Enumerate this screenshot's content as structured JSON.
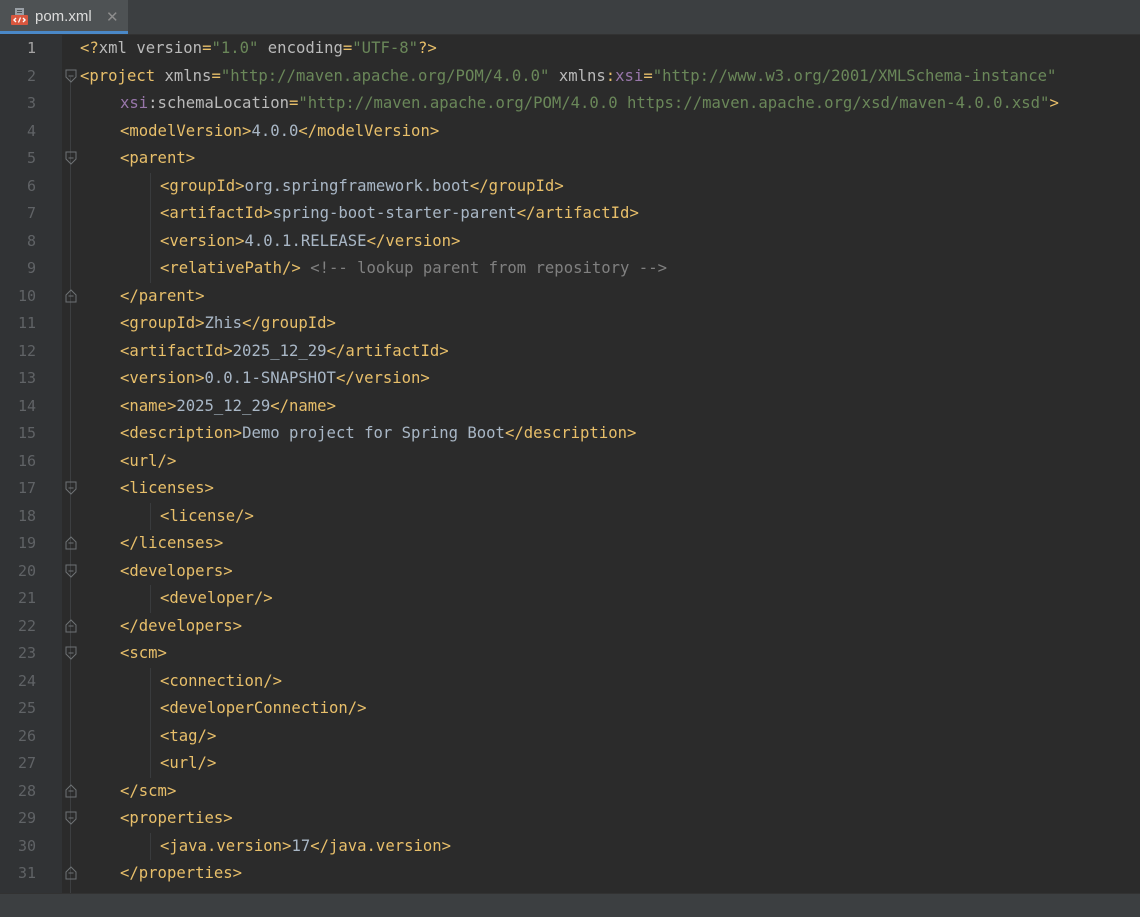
{
  "tab": {
    "label": "pom.xml",
    "close": "✕",
    "icon": "xml-file-icon"
  },
  "lines": [
    {
      "n": "1",
      "indent": 0,
      "fold": "none",
      "tokens": [
        [
          "t",
          "<?"
        ],
        [
          "a",
          "xml"
        ],
        [
          "a",
          " version"
        ],
        [
          "t",
          "="
        ],
        [
          "v",
          "\"1.0\""
        ],
        [
          "a",
          " encoding"
        ],
        [
          "t",
          "="
        ],
        [
          "v",
          "\"UTF-8\""
        ],
        [
          "t",
          "?>"
        ]
      ]
    },
    {
      "n": "2",
      "indent": 0,
      "fold": "open",
      "tokens": [
        [
          "t",
          "<project"
        ],
        [
          "a",
          " xmlns"
        ],
        [
          "t",
          "="
        ],
        [
          "v",
          "\"http://maven.apache.org/POM/4.0.0\""
        ],
        [
          "a",
          " xmlns"
        ],
        [
          "t",
          ":"
        ],
        [
          "ns",
          "xsi"
        ],
        [
          "t",
          "="
        ],
        [
          "v",
          "\"http://www.w3.org/2001/XMLSchema-instance\""
        ]
      ]
    },
    {
      "n": "3",
      "indent": 1,
      "fold": "none",
      "tokens": [
        [
          "ns",
          "xsi"
        ],
        [
          "a",
          ":schemaLocation"
        ],
        [
          "t",
          "="
        ],
        [
          "v",
          "\"http://maven.apache.org/POM/4.0.0 https://maven.apache.org/xsd/maven-4.0.0.xsd\""
        ],
        [
          "t",
          ">"
        ]
      ]
    },
    {
      "n": "4",
      "indent": 1,
      "fold": "none",
      "tokens": [
        [
          "t",
          "<modelVersion>"
        ],
        [
          "txt",
          "4.0.0"
        ],
        [
          "t",
          "</modelVersion>"
        ]
      ]
    },
    {
      "n": "5",
      "indent": 1,
      "fold": "open",
      "tokens": [
        [
          "t",
          "<parent>"
        ]
      ]
    },
    {
      "n": "6",
      "indent": 2,
      "fold": "none",
      "tokens": [
        [
          "t",
          "<groupId>"
        ],
        [
          "txt",
          "org.springframework.boot"
        ],
        [
          "t",
          "</groupId>"
        ]
      ]
    },
    {
      "n": "7",
      "indent": 2,
      "fold": "none",
      "tokens": [
        [
          "t",
          "<artifactId>"
        ],
        [
          "txt",
          "spring-boot-starter-parent"
        ],
        [
          "t",
          "</artifactId>"
        ]
      ]
    },
    {
      "n": "8",
      "indent": 2,
      "fold": "none",
      "tokens": [
        [
          "t",
          "<version>"
        ],
        [
          "txt",
          "4.0.1.RELEASE"
        ],
        [
          "t",
          "</version>"
        ]
      ]
    },
    {
      "n": "9",
      "indent": 2,
      "fold": "none",
      "tokens": [
        [
          "t",
          "<relativePath/>"
        ],
        [
          "c",
          " <!-- lookup parent from repository -->"
        ]
      ]
    },
    {
      "n": "10",
      "indent": 1,
      "fold": "close",
      "tokens": [
        [
          "t",
          "</parent>"
        ]
      ]
    },
    {
      "n": "11",
      "indent": 1,
      "fold": "none",
      "tokens": [
        [
          "t",
          "<groupId>"
        ],
        [
          "txt",
          "Zhis"
        ],
        [
          "t",
          "</groupId>"
        ]
      ]
    },
    {
      "n": "12",
      "indent": 1,
      "fold": "none",
      "tokens": [
        [
          "t",
          "<artifactId>"
        ],
        [
          "txt",
          "2025_12_29"
        ],
        [
          "t",
          "</artifactId>"
        ]
      ]
    },
    {
      "n": "13",
      "indent": 1,
      "fold": "none",
      "tokens": [
        [
          "t",
          "<version>"
        ],
        [
          "txt",
          "0.0.1-SNAPSHOT"
        ],
        [
          "t",
          "</version>"
        ]
      ]
    },
    {
      "n": "14",
      "indent": 1,
      "fold": "none",
      "tokens": [
        [
          "t",
          "<name>"
        ],
        [
          "txt",
          "2025_12_29"
        ],
        [
          "t",
          "</name>"
        ]
      ]
    },
    {
      "n": "15",
      "indent": 1,
      "fold": "none",
      "tokens": [
        [
          "t",
          "<description>"
        ],
        [
          "txt",
          "Demo project for Spring Boot"
        ],
        [
          "t",
          "</description>"
        ]
      ]
    },
    {
      "n": "16",
      "indent": 1,
      "fold": "none",
      "tokens": [
        [
          "t",
          "<url/>"
        ]
      ]
    },
    {
      "n": "17",
      "indent": 1,
      "fold": "open",
      "tokens": [
        [
          "t",
          "<licenses>"
        ]
      ]
    },
    {
      "n": "18",
      "indent": 2,
      "fold": "none",
      "tokens": [
        [
          "t",
          "<license/>"
        ]
      ]
    },
    {
      "n": "19",
      "indent": 1,
      "fold": "close",
      "tokens": [
        [
          "t",
          "</licenses>"
        ]
      ]
    },
    {
      "n": "20",
      "indent": 1,
      "fold": "open",
      "tokens": [
        [
          "t",
          "<developers>"
        ]
      ]
    },
    {
      "n": "21",
      "indent": 2,
      "fold": "none",
      "tokens": [
        [
          "t",
          "<developer/>"
        ]
      ]
    },
    {
      "n": "22",
      "indent": 1,
      "fold": "close",
      "tokens": [
        [
          "t",
          "</developers>"
        ]
      ]
    },
    {
      "n": "23",
      "indent": 1,
      "fold": "open",
      "tokens": [
        [
          "t",
          "<scm>"
        ]
      ]
    },
    {
      "n": "24",
      "indent": 2,
      "fold": "none",
      "tokens": [
        [
          "t",
          "<connection/>"
        ]
      ]
    },
    {
      "n": "25",
      "indent": 2,
      "fold": "none",
      "tokens": [
        [
          "t",
          "<developerConnection/>"
        ]
      ]
    },
    {
      "n": "26",
      "indent": 2,
      "fold": "none",
      "tokens": [
        [
          "t",
          "<tag/>"
        ]
      ]
    },
    {
      "n": "27",
      "indent": 2,
      "fold": "none",
      "tokens": [
        [
          "t",
          "<url/>"
        ]
      ]
    },
    {
      "n": "28",
      "indent": 1,
      "fold": "close",
      "tokens": [
        [
          "t",
          "</scm>"
        ]
      ]
    },
    {
      "n": "29",
      "indent": 1,
      "fold": "open",
      "tokens": [
        [
          "t",
          "<properties>"
        ]
      ]
    },
    {
      "n": "30",
      "indent": 2,
      "fold": "none",
      "tokens": [
        [
          "t",
          "<java.version>"
        ],
        [
          "txt",
          "17"
        ],
        [
          "t",
          "</java.version>"
        ]
      ]
    },
    {
      "n": "31",
      "indent": 1,
      "fold": "close",
      "tokens": [
        [
          "t",
          "</properties>"
        ]
      ]
    }
  ]
}
